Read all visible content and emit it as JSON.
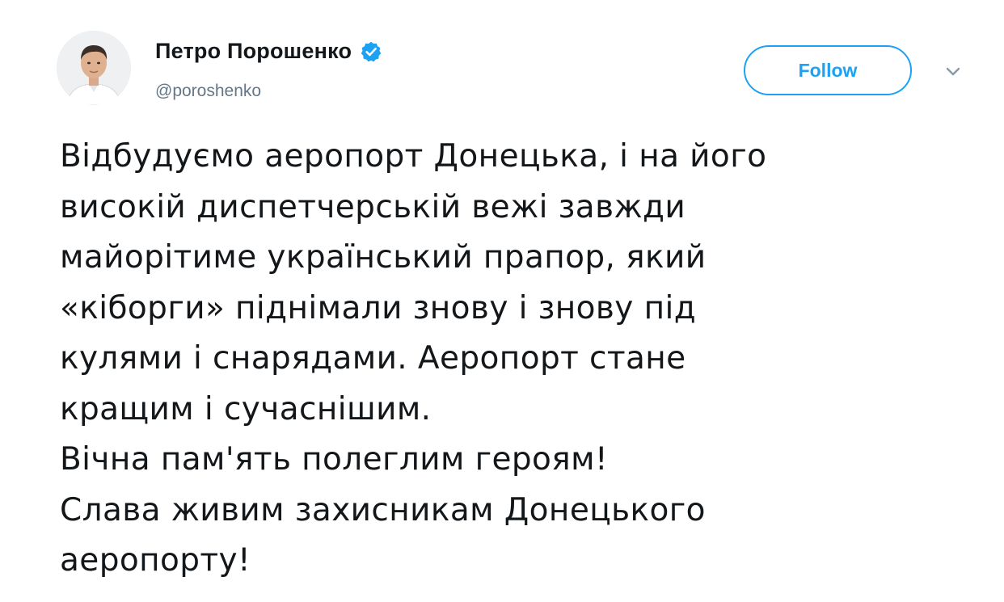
{
  "author": {
    "name": "Петро Порошенко",
    "handle": "@poroshenko",
    "verified": true,
    "verified_icon": "verified-badge-icon",
    "avatar": "profile-photo"
  },
  "actions": {
    "follow_label": "Follow",
    "more_icon": "chevron-down-icon"
  },
  "tweet": {
    "lines": [
      "Відбудуємо аеропорт Донецька, і на його",
      "високій диспетчерській вежі завжди",
      "майорітиме український прапор, який",
      "«кіборги» піднімали знову і знову під",
      "кулями і снарядами. Аеропорт стане",
      "кращим і сучаснішим.",
      "Вічна пам'ять полеглим героям!",
      "Слава живим захисникам Донецького",
      "аеропорту!"
    ]
  },
  "colors": {
    "accent": "#1da1f2",
    "text": "#14171a",
    "secondary_text": "#657786"
  }
}
